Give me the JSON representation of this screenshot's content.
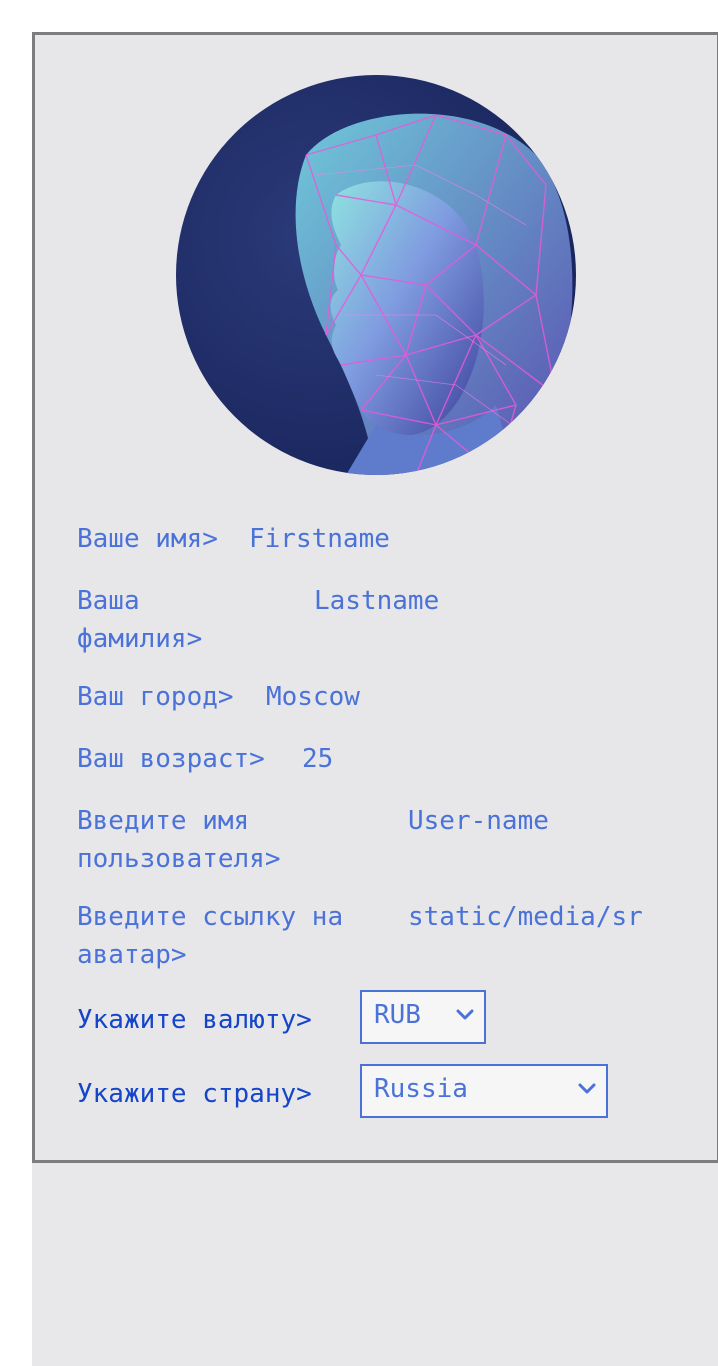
{
  "profile": {
    "avatar_icon": "portrait-image",
    "fields": [
      {
        "label": "Ваше имя>",
        "value": "Firstname"
      },
      {
        "label": "Ваша\nфамилия>",
        "value": "Lastname"
      },
      {
        "label": "Ваш город>",
        "value": "Moscow"
      },
      {
        "label": "Ваш возраст>",
        "value": "25"
      },
      {
        "label": "Введите имя\nпользователя>",
        "value": "User-name"
      },
      {
        "label": "Введите ссылку на\nаватар>",
        "value": "static/media/sr"
      }
    ],
    "currency": {
      "label": "Укажите валюту>",
      "selected": "RUB"
    },
    "country": {
      "label": "Укажите страну>",
      "selected": "Russia"
    }
  },
  "colors": {
    "accent": "#4a72d8",
    "label_dark": "#1545c8",
    "card_bg": "#e7e7ea",
    "border": "#7d7d7d"
  }
}
